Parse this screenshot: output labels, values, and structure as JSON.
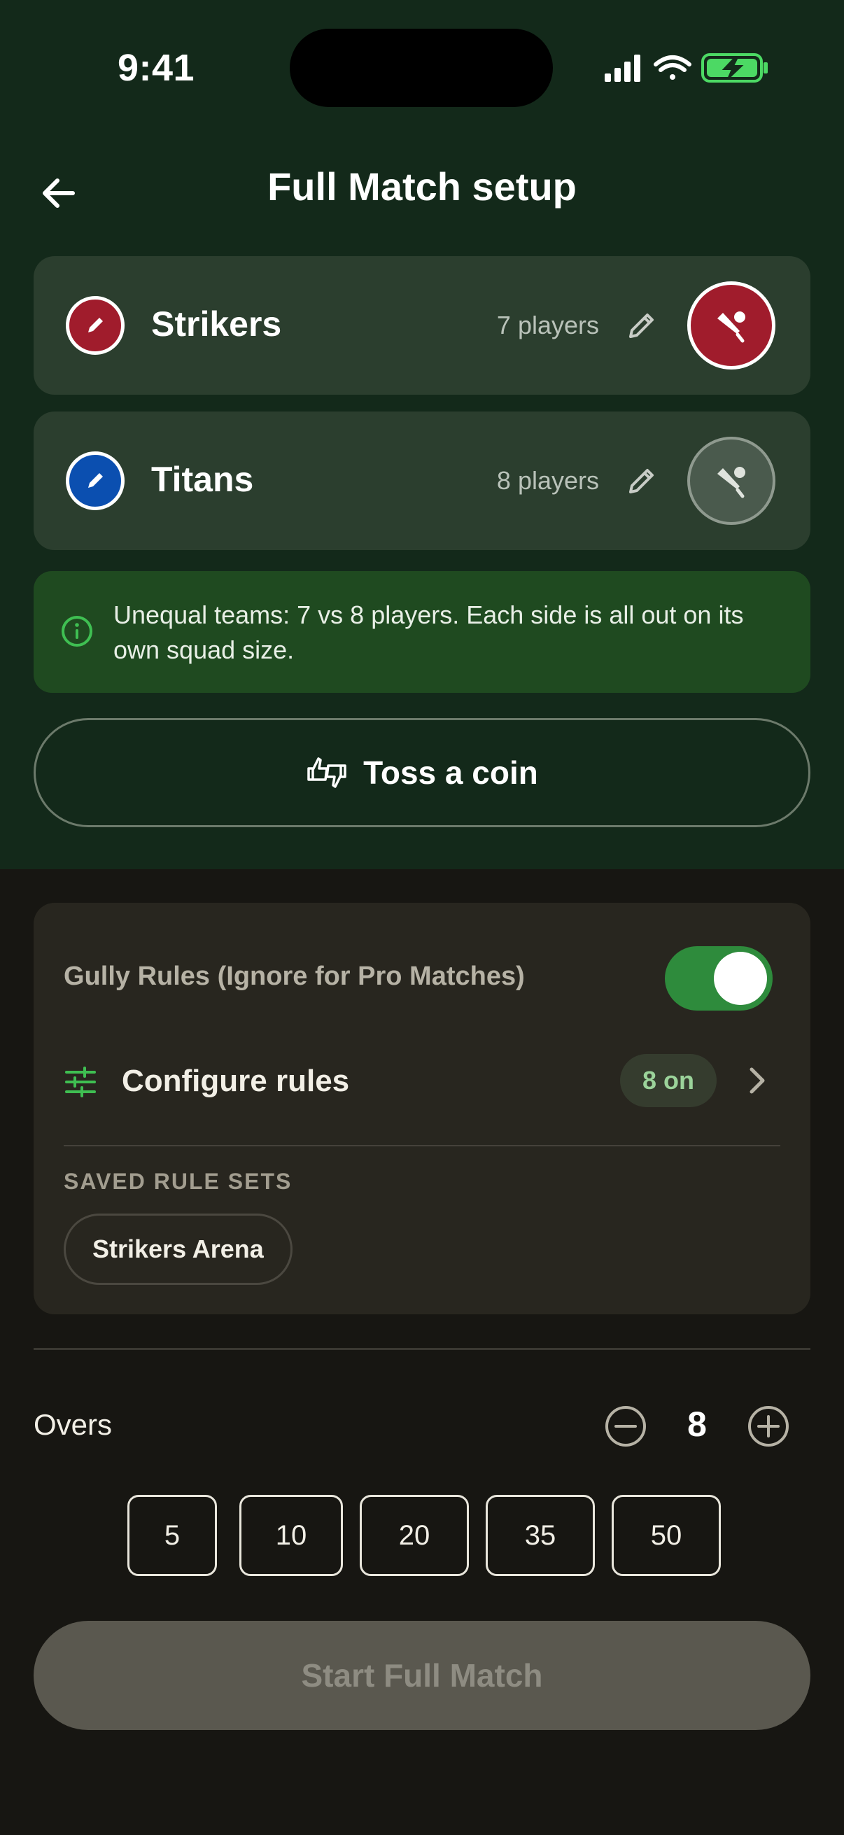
{
  "status_bar": {
    "time": "9:41"
  },
  "header": {
    "title": "Full Match setup",
    "back_icon": "arrow-left-icon"
  },
  "teams": [
    {
      "name": "Strikers",
      "players": "7 players",
      "color": "#a01c2c",
      "selected": true
    },
    {
      "name": "Titans",
      "players": "8 players",
      "color": "#0b4fb0",
      "selected": false
    }
  ],
  "notice": {
    "icon": "info-icon",
    "text": "Unequal teams: 7 vs 8 players. Each side is all out on its own squad size."
  },
  "toss": {
    "label": "Toss a coin",
    "icon": "thumbs-up-down-icon"
  },
  "rules": {
    "gully_label": "Gully Rules (Ignore for Pro Matches)",
    "gully_enabled": true,
    "configure_label": "Configure rules",
    "configure_badge": "8 on",
    "saved_heading": "SAVED RULE SETS",
    "saved_sets": [
      "Strikers Arena"
    ]
  },
  "overs": {
    "label": "Overs",
    "value": "8",
    "presets": [
      "5",
      "10",
      "20",
      "35",
      "50"
    ]
  },
  "start_button": {
    "label": "Start Full Match"
  },
  "colors": {
    "header_bg": "#13291a",
    "page_bg": "#171612",
    "accent_green": "#2e8b3c",
    "notice_bg": "#1f4a20"
  }
}
